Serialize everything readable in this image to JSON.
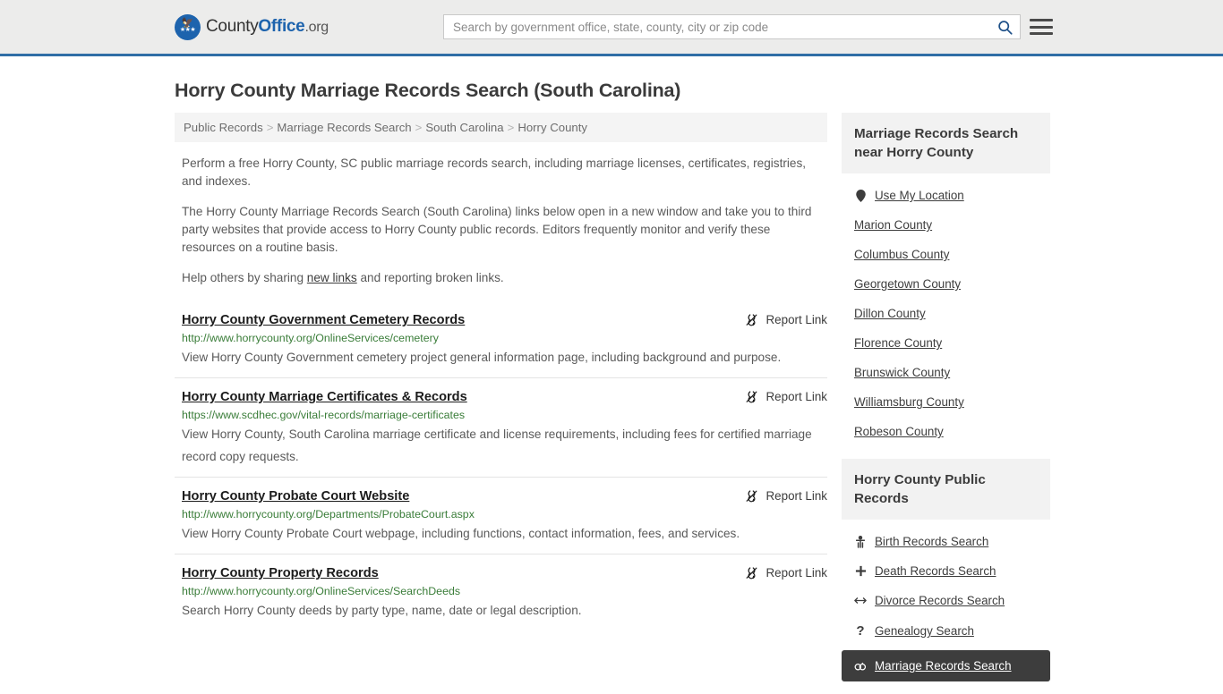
{
  "header": {
    "logo": {
      "part1": "County",
      "part2": "Office",
      "part3": ".org",
      "icon": "eagle-seal-icon"
    },
    "search": {
      "placeholder": "Search by government office, state, county, city or zip code",
      "value": "",
      "icon": "search-icon"
    },
    "menu_icon": "hamburger-menu-icon",
    "accent_color": "#2f6ea6"
  },
  "page": {
    "title": "Horry County Marriage Records Search (South Carolina)"
  },
  "breadcrumb": {
    "separator": ">",
    "items": [
      "Public Records",
      "Marriage Records Search",
      "South Carolina",
      "Horry County"
    ]
  },
  "intro": {
    "p1": "Perform a free Horry County, SC public marriage records search, including marriage licenses, certificates, registries, and indexes.",
    "p2": "The Horry County Marriage Records Search (South Carolina) links below open in a new window and take you to third party websites that provide access to Horry County public records. Editors frequently monitor and verify these resources on a routine basis.",
    "p3_before": "Help others by sharing ",
    "p3_link": "new links",
    "p3_after": " and reporting broken links."
  },
  "results": {
    "report_label": "Report Link",
    "report_icon": "broken-link-icon",
    "items": [
      {
        "title": "Horry County Government Cemetery Records",
        "url": "http://www.horrycounty.org/OnlineServices/cemetery",
        "description": "View Horry County Government cemetery project general information page, including background and purpose."
      },
      {
        "title": "Horry County Marriage Certificates & Records",
        "url": "https://www.scdhec.gov/vital-records/marriage-certificates",
        "description": "View Horry County, South Carolina marriage certificate and license requirements, including fees for certified marriage record copy requests."
      },
      {
        "title": "Horry County Probate Court Website",
        "url": "http://www.horrycounty.org/Departments/ProbateCourt.aspx",
        "description": "View Horry County Probate Court webpage, including functions, contact information, fees, and services."
      },
      {
        "title": "Horry County Property Records",
        "url": "http://www.horrycounty.org/OnlineServices/SearchDeeds",
        "description": "Search Horry County deeds by party type, name, date or legal description."
      }
    ]
  },
  "sidebar": {
    "nearby": {
      "heading": "Marriage Records Search near Horry County",
      "items": [
        {
          "label": "Use My Location",
          "icon": "map-pin-icon"
        },
        {
          "label": "Marion County",
          "icon": ""
        },
        {
          "label": "Columbus County",
          "icon": ""
        },
        {
          "label": "Georgetown County",
          "icon": ""
        },
        {
          "label": "Dillon County",
          "icon": ""
        },
        {
          "label": "Florence County",
          "icon": ""
        },
        {
          "label": "Brunswick County",
          "icon": ""
        },
        {
          "label": "Williamsburg County",
          "icon": ""
        },
        {
          "label": "Robeson County",
          "icon": ""
        }
      ]
    },
    "public_records": {
      "heading": "Horry County Public Records",
      "items": [
        {
          "label": "Birth Records Search",
          "icon": "baby-icon",
          "glyph": "Ɣ",
          "active": false
        },
        {
          "label": "Death Records Search",
          "icon": "cross-icon",
          "glyph": "✚",
          "active": false
        },
        {
          "label": "Divorce Records Search",
          "icon": "left-right-arrow-icon",
          "glyph": "↔",
          "active": false
        },
        {
          "label": "Genealogy Search",
          "icon": "question-mark-icon",
          "glyph": "?",
          "active": false
        },
        {
          "label": "Marriage Records Search",
          "icon": "wedding-rings-icon",
          "glyph": "⚭",
          "active": true
        }
      ],
      "active_bg": "#3d3d3d"
    }
  }
}
